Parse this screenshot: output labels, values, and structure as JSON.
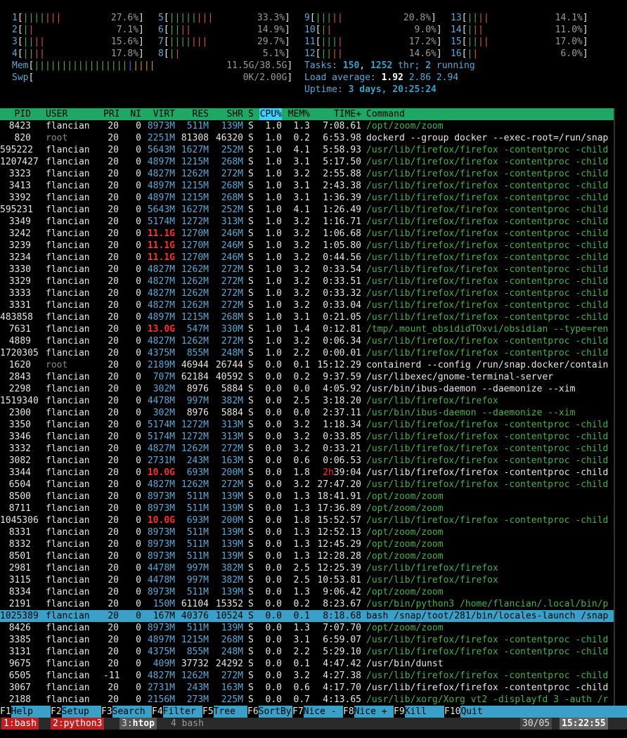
{
  "cpus": [
    {
      "id": "1",
      "g": 4,
      "r": 3,
      "pct": "27.6%"
    },
    {
      "id": "2",
      "g": 1,
      "r": 1,
      "pct": "7.1%"
    },
    {
      "id": "3",
      "g": 2,
      "r": 2,
      "pct": "15.6%"
    },
    {
      "id": "4",
      "g": 2,
      "r": 2,
      "pct": "17.8%"
    },
    {
      "id": "5",
      "g": 5,
      "r": 3,
      "pct": "33.3%"
    },
    {
      "id": "6",
      "g": 2,
      "r": 2,
      "pct": "14.9%"
    },
    {
      "id": "7",
      "g": 4,
      "r": 3,
      "pct": "29.7%"
    },
    {
      "id": "8",
      "g": 1,
      "r": 1,
      "pct": "5.1%"
    },
    {
      "id": "9",
      "g": 3,
      "r": 2,
      "pct": "20.8%"
    },
    {
      "id": "10",
      "g": 1,
      "r": 1,
      "pct": "9.0%"
    },
    {
      "id": "11",
      "g": 3,
      "r": 1,
      "pct": "17.2%"
    },
    {
      "id": "12",
      "g": 2,
      "r": 2,
      "pct": "14.6%"
    },
    {
      "id": "13",
      "g": 2,
      "r": 2,
      "pct": "14.1%"
    },
    {
      "id": "14",
      "g": 1,
      "r": 2,
      "pct": "11.0%"
    },
    {
      "id": "15",
      "g": 2,
      "r": 2,
      "pct": "17.0%"
    },
    {
      "id": "16",
      "g": 1,
      "r": 1,
      "pct": "6.0%"
    }
  ],
  "mem": {
    "label": "Mem",
    "value": "11.5G/38.5G"
  },
  "swp": {
    "label": "Swp",
    "value": "0K/2.00G"
  },
  "tasks": {
    "label": "Tasks:",
    "count": "150",
    "thr": "1252",
    "thr_label": "thr;",
    "running": "2",
    "running_label": "running"
  },
  "load": {
    "label": "Load average:",
    "v1": "1.92",
    "v2": "2.86",
    "v3": "2.94"
  },
  "uptime": {
    "label": "Uptime:",
    "value": "3 days, 20:25:24"
  },
  "header": {
    "pid": "PID",
    "user": "USER",
    "pri": "PRI",
    "ni": "NI",
    "virt": "VIRT",
    "res": "RES",
    "shr": "SHR",
    "s": "S",
    "cpu": "CPU%",
    "mem": "MEM%",
    "time": "TIME+",
    "cmd": "Command"
  },
  "processes": [
    [
      "8423",
      "flancian",
      "20",
      "0",
      "8973M",
      "511M",
      "139M",
      "S",
      "1.0",
      "1.3",
      "7:08.61",
      "/opt/zoom/zoom",
      "g",
      "",
      ""
    ],
    [
      "820",
      "root",
      "20",
      "0",
      "2251M",
      "81308",
      "46320",
      "S",
      "1.0",
      "0.2",
      "6:53.98",
      "dockerd --group docker --exec-root=/run/snap",
      "w",
      "",
      ""
    ],
    [
      "595222",
      "flancian",
      "20",
      "0",
      "5643M",
      "1627M",
      "252M",
      "S",
      "1.0",
      "4.1",
      "5:58.93",
      "/usr/lib/firefox/firefox -contentproc -child",
      "g",
      "",
      ""
    ],
    [
      "1207427",
      "flancian",
      "20",
      "0",
      "4897M",
      "1215M",
      "268M",
      "S",
      "1.0",
      "3.1",
      "5:17.50",
      "/usr/lib/firefox/firefox -contentproc -child",
      "g",
      "",
      ""
    ],
    [
      "3323",
      "flancian",
      "20",
      "0",
      "4827M",
      "1262M",
      "272M",
      "S",
      "1.0",
      "3.2",
      "2:55.88",
      "/usr/lib/firefox/firefox -contentproc -child",
      "g",
      "",
      ""
    ],
    [
      "3413",
      "flancian",
      "20",
      "0",
      "4897M",
      "1215M",
      "268M",
      "S",
      "1.0",
      "3.1",
      "2:43.38",
      "/usr/lib/firefox/firefox -contentproc -child",
      "g",
      "",
      ""
    ],
    [
      "3392",
      "flancian",
      "20",
      "0",
      "4897M",
      "1215M",
      "268M",
      "S",
      "1.0",
      "3.1",
      "1:36.39",
      "/usr/lib/firefox/firefox -contentproc -child",
      "g",
      "",
      ""
    ],
    [
      "595231",
      "flancian",
      "20",
      "0",
      "5643M",
      "1627M",
      "252M",
      "S",
      "1.0",
      "4.1",
      "1:26.49",
      "/usr/lib/firefox/firefox -contentproc -child",
      "g",
      "",
      ""
    ],
    [
      "3349",
      "flancian",
      "20",
      "0",
      "5174M",
      "1272M",
      "313M",
      "S",
      "1.0",
      "3.2",
      "1:16.71",
      "/usr/lib/firefox/firefox -contentproc -child",
      "g",
      "",
      ""
    ],
    [
      "3242",
      "flancian",
      "20",
      "0",
      "11.1G",
      "1270M",
      "246M",
      "S",
      "1.0",
      "3.2",
      "1:06.68",
      "/usr/lib/firefox/firefox -contentproc -child",
      "g",
      "r",
      ""
    ],
    [
      "3239",
      "flancian",
      "20",
      "0",
      "11.1G",
      "1270M",
      "246M",
      "S",
      "1.0",
      "3.2",
      "1:05.80",
      "/usr/lib/firefox/firefox -contentproc -child",
      "g",
      "r",
      ""
    ],
    [
      "3234",
      "flancian",
      "20",
      "0",
      "11.1G",
      "1270M",
      "246M",
      "S",
      "1.0",
      "3.2",
      "0:44.56",
      "/usr/lib/firefox/firefox -contentproc -child",
      "g",
      "r",
      ""
    ],
    [
      "3330",
      "flancian",
      "20",
      "0",
      "4827M",
      "1262M",
      "272M",
      "S",
      "1.0",
      "3.2",
      "0:33.54",
      "/usr/lib/firefox/firefox -contentproc -child",
      "g",
      "",
      ""
    ],
    [
      "3329",
      "flancian",
      "20",
      "0",
      "4827M",
      "1262M",
      "272M",
      "S",
      "1.0",
      "3.2",
      "0:33.51",
      "/usr/lib/firefox/firefox -contentproc -child",
      "g",
      "",
      ""
    ],
    [
      "3333",
      "flancian",
      "20",
      "0",
      "4827M",
      "1262M",
      "272M",
      "S",
      "1.0",
      "3.2",
      "0:33.32",
      "/usr/lib/firefox/firefox -contentproc -child",
      "g",
      "",
      ""
    ],
    [
      "3331",
      "flancian",
      "20",
      "0",
      "4827M",
      "1262M",
      "272M",
      "S",
      "1.0",
      "3.2",
      "0:33.04",
      "/usr/lib/firefox/firefox -contentproc -child",
      "g",
      "",
      ""
    ],
    [
      "483858",
      "flancian",
      "20",
      "0",
      "4897M",
      "1215M",
      "268M",
      "S",
      "1.0",
      "3.1",
      "0:21.05",
      "/usr/lib/firefox/firefox -contentproc -child",
      "g",
      "",
      ""
    ],
    [
      "7631",
      "flancian",
      "20",
      "0",
      "13.0G",
      "547M",
      "330M",
      "S",
      "1.0",
      "1.4",
      "0:12.81",
      "/tmp/.mount_obsididTOxvi/obsidian --type=ren",
      "g",
      "r",
      ""
    ],
    [
      "4889",
      "flancian",
      "20",
      "0",
      "4827M",
      "1262M",
      "272M",
      "S",
      "1.0",
      "3.2",
      "0:06.34",
      "/usr/lib/firefox/firefox -contentproc -child",
      "g",
      "",
      ""
    ],
    [
      "1720305",
      "flancian",
      "20",
      "0",
      "4375M",
      "855M",
      "248M",
      "S",
      "1.0",
      "2.2",
      "0:00.01",
      "/usr/lib/firefox/firefox -contentproc -child",
      "g",
      "",
      ""
    ],
    [
      "1620",
      "root",
      "20",
      "0",
      "2189M",
      "46944",
      "26744",
      "S",
      "0.0",
      "0.1",
      "15:12.29",
      "containerd --config /run/snap.docker/contain",
      "w",
      "",
      ""
    ],
    [
      "2843",
      "flancian",
      "20",
      "0",
      "707M",
      "62184",
      "40592",
      "S",
      "0.0",
      "0.2",
      "9:37.59",
      "/usr/libexec/gnome-terminal-server",
      "w",
      "",
      ""
    ],
    [
      "2298",
      "flancian",
      "20",
      "0",
      "302M",
      "8976",
      "5884",
      "S",
      "0.0",
      "0.0",
      "4:05.92",
      "/usr/bin/ibus-daemon --daemonize --xim",
      "w",
      "",
      ""
    ],
    [
      "1519340",
      "flancian",
      "20",
      "0",
      "4478M",
      "997M",
      "382M",
      "S",
      "0.0",
      "2.5",
      "3:18.20",
      "/usr/lib/firefox/firefox",
      "g",
      "",
      ""
    ],
    [
      "2300",
      "flancian",
      "20",
      "0",
      "302M",
      "8976",
      "5884",
      "S",
      "0.0",
      "0.0",
      "2:37.11",
      "/usr/bin/ibus-daemon --daemonize --xim",
      "g",
      "",
      ""
    ],
    [
      "3350",
      "flancian",
      "20",
      "0",
      "5174M",
      "1272M",
      "313M",
      "S",
      "0.0",
      "3.2",
      "1:18.34",
      "/usr/lib/firefox/firefox -contentproc -child",
      "g",
      "",
      ""
    ],
    [
      "3346",
      "flancian",
      "20",
      "0",
      "5174M",
      "1272M",
      "313M",
      "S",
      "0.0",
      "3.2",
      "0:33.85",
      "/usr/lib/firefox/firefox -contentproc -child",
      "g",
      "",
      ""
    ],
    [
      "3332",
      "flancian",
      "20",
      "0",
      "4827M",
      "1262M",
      "272M",
      "S",
      "0.0",
      "3.2",
      "0:33.21",
      "/usr/lib/firefox/firefox -contentproc -child",
      "g",
      "",
      ""
    ],
    [
      "3082",
      "flancian",
      "20",
      "0",
      "2731M",
      "243M",
      "163M",
      "S",
      "0.0",
      "0.6",
      "0:06.53",
      "/usr/lib/firefox/firefox -contentproc -child",
      "g",
      "",
      ""
    ],
    [
      "3344",
      "flancian",
      "20",
      "0",
      "10.0G",
      "693M",
      "200M",
      "S",
      "0.0",
      "1.8",
      "2h39:04",
      "/usr/lib/firefox/firefox -contentproc -child",
      "w",
      "r",
      "h"
    ],
    [
      "6504",
      "flancian",
      "20",
      "0",
      "4827M",
      "1262M",
      "272M",
      "S",
      "0.0",
      "3.2",
      "27:47.20",
      "/usr/lib/firefox/firefox -contentproc -child",
      "g",
      "",
      ""
    ],
    [
      "8500",
      "flancian",
      "20",
      "0",
      "8973M",
      "511M",
      "139M",
      "S",
      "0.0",
      "1.3",
      "18:41.91",
      "/opt/zoom/zoom",
      "g",
      "",
      ""
    ],
    [
      "8711",
      "flancian",
      "20",
      "0",
      "8973M",
      "511M",
      "139M",
      "S",
      "0.0",
      "1.3",
      "17:36.89",
      "/opt/zoom/zoom",
      "g",
      "",
      ""
    ],
    [
      "1045306",
      "flancian",
      "20",
      "0",
      "10.0G",
      "693M",
      "200M",
      "S",
      "0.0",
      "1.8",
      "15:52.57",
      "/usr/lib/firefox/firefox -contentproc -child",
      "g",
      "r",
      ""
    ],
    [
      "8331",
      "flancian",
      "20",
      "0",
      "8973M",
      "511M",
      "139M",
      "S",
      "0.0",
      "1.3",
      "12:52.13",
      "/opt/zoom/zoom",
      "g",
      "",
      ""
    ],
    [
      "8332",
      "flancian",
      "20",
      "0",
      "8973M",
      "511M",
      "139M",
      "S",
      "0.0",
      "1.3",
      "12:45.29",
      "/opt/zoom/zoom",
      "g",
      "",
      ""
    ],
    [
      "8501",
      "flancian",
      "20",
      "0",
      "8973M",
      "511M",
      "139M",
      "S",
      "0.0",
      "1.3",
      "12:28.28",
      "/opt/zoom/zoom",
      "g",
      "",
      ""
    ],
    [
      "2981",
      "flancian",
      "20",
      "0",
      "4478M",
      "997M",
      "382M",
      "S",
      "0.0",
      "2.5",
      "12:25.39",
      "/usr/lib/firefox/firefox",
      "g",
      "",
      ""
    ],
    [
      "3115",
      "flancian",
      "20",
      "0",
      "4478M",
      "997M",
      "382M",
      "S",
      "0.0",
      "2.5",
      "10:53.81",
      "/usr/lib/firefox/firefox",
      "g",
      "",
      ""
    ],
    [
      "8334",
      "flancian",
      "20",
      "0",
      "8973M",
      "511M",
      "139M",
      "S",
      "0.0",
      "1.3",
      "9:06.42",
      "/opt/zoom/zoom",
      "g",
      "",
      ""
    ],
    [
      "2191",
      "flancian",
      "20",
      "0",
      "150M",
      "61104",
      "15352",
      "S",
      "0.0",
      "0.2",
      "8:23.67",
      "/usr/bin/python3 /home/flancian/.local/bin/p",
      "g",
      "",
      ""
    ],
    [
      "1025389",
      "flancian",
      "20",
      "0",
      "167M",
      "40376",
      "10524",
      "S",
      "0.0",
      "0.1",
      "8:18.68",
      "bash /snap/toot/281/bin/locales-launch /snap",
      "w",
      "",
      "sel"
    ],
    [
      "8426",
      "flancian",
      "20",
      "0",
      "8973M",
      "511M",
      "139M",
      "S",
      "0.0",
      "1.3",
      "7:07.70",
      "/opt/zoom/zoom",
      "g",
      "",
      ""
    ],
    [
      "3385",
      "flancian",
      "20",
      "0",
      "4897M",
      "1215M",
      "268M",
      "S",
      "0.0",
      "3.1",
      "6:59.07",
      "/usr/lib/firefox/firefox -contentproc -child",
      "g",
      "",
      ""
    ],
    [
      "3131",
      "flancian",
      "20",
      "0",
      "4375M",
      "855M",
      "248M",
      "S",
      "0.0",
      "2.2",
      "5:29.10",
      "/usr/lib/firefox/firefox -contentproc -child",
      "g",
      "",
      ""
    ],
    [
      "9675",
      "flancian",
      "20",
      "0",
      "409M",
      "37732",
      "24292",
      "S",
      "0.0",
      "0.1",
      "4:47.42",
      "/usr/bin/dunst",
      "w",
      "",
      ""
    ],
    [
      "6505",
      "flancian",
      "-11",
      "0",
      "4827M",
      "1262M",
      "272M",
      "S",
      "0.0",
      "3.2",
      "4:27.38",
      "/usr/lib/firefox/firefox -contentproc -child",
      "g",
      "",
      ""
    ],
    [
      "3067",
      "flancian",
      "20",
      "0",
      "2731M",
      "243M",
      "163M",
      "S",
      "0.0",
      "0.6",
      "4:17.70",
      "/usr/lib/firefox/firefox -contentproc -child",
      "w",
      "",
      ""
    ],
    [
      "2188",
      "flancian",
      "20",
      "0",
      "2156M",
      "273M",
      "225M",
      "S",
      "0.0",
      "0.7",
      "4:13.65",
      "/usr/lib/xorg/Xorg vt2 -displayfd 3 -auth /r",
      "g",
      "",
      ""
    ]
  ],
  "fkeys": [
    {
      "k": "F1",
      "l": "Help  "
    },
    {
      "k": "F2",
      "l": "Setup "
    },
    {
      "k": "F3",
      "l": "Search"
    },
    {
      "k": "F4",
      "l": "Filter"
    },
    {
      "k": "F5",
      "l": "Tree  "
    },
    {
      "k": "F6",
      "l": "SortBy"
    },
    {
      "k": "F7",
      "l": "Nice - "
    },
    {
      "k": "F8",
      "l": "Nice + "
    },
    {
      "k": "F9",
      "l": "Kill  "
    },
    {
      "k": "F10",
      "l": "Quit  "
    }
  ],
  "tmux": {
    "windows": [
      {
        "num": "1",
        "name": "bash",
        "color": "#c02020"
      },
      {
        "num": "2",
        "name": "python3",
        "color": "#c02020"
      },
      {
        "num": "3",
        "name": "htop",
        "color": "#555555"
      },
      {
        "num": "4",
        "name": "bash",
        "color": "#2a2a2a"
      }
    ],
    "date": "30/05",
    "time": "15:22:55"
  }
}
